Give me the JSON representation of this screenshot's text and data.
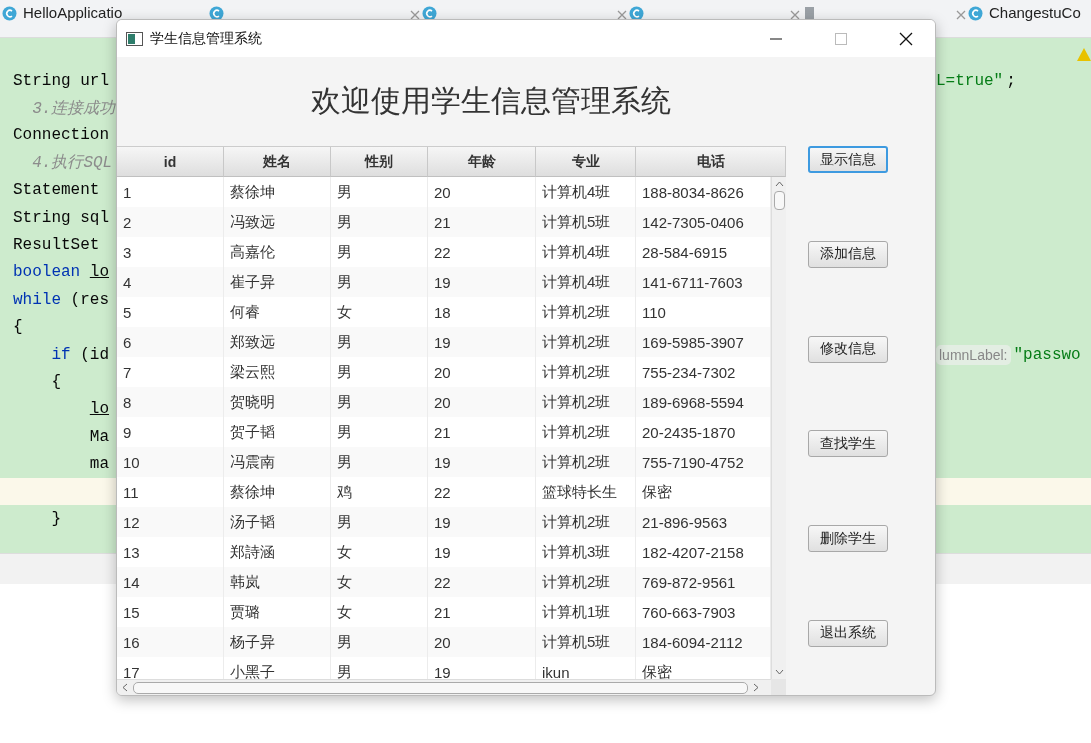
{
  "ide": {
    "tabs": [
      {
        "kind": "labeled",
        "label": "HelloApplicatio"
      },
      {
        "kind": "covered"
      },
      {
        "kind": "covered"
      },
      {
        "kind": "covered"
      },
      {
        "kind": "covered"
      },
      {
        "kind": "labeled",
        "label": "ChangestuCo"
      }
    ],
    "code_lines": [
      {
        "current": false,
        "segments": [
          {
            "kind": "plain",
            "text": "String url"
          }
        ],
        "tail": [
          {
            "kind": "string",
            "text": "L=true\""
          },
          {
            "kind": "plain",
            "text": ";"
          }
        ]
      },
      {
        "current": false,
        "segments": [
          {
            "kind": "comment",
            "text": "  3.连接成功"
          }
        ]
      },
      {
        "current": false,
        "segments": [
          {
            "kind": "plain",
            "text": "Connection"
          }
        ]
      },
      {
        "current": false,
        "segments": [
          {
            "kind": "comment",
            "text": "  4.执行SQL"
          }
        ]
      },
      {
        "current": false,
        "segments": [
          {
            "kind": "plain",
            "text": "Statement"
          }
        ]
      },
      {
        "current": false,
        "segments": [
          {
            "kind": "plain",
            "text": "String sql"
          }
        ]
      },
      {
        "current": false,
        "segments": [
          {
            "kind": "plain",
            "text": "ResultSet"
          }
        ]
      },
      {
        "current": false,
        "segments": [
          {
            "kind": "keyword",
            "text": "boolean "
          },
          {
            "kind": "underlined",
            "text": "lo"
          }
        ]
      },
      {
        "current": false,
        "segments": [
          {
            "kind": "keyword",
            "text": "while"
          },
          {
            "kind": "plain",
            "text": " (res"
          }
        ]
      },
      {
        "current": false,
        "segments": [
          {
            "kind": "plain",
            "text": "{"
          }
        ]
      },
      {
        "current": false,
        "segments": [
          {
            "kind": "keyword",
            "text": "    if"
          },
          {
            "kind": "plain",
            "text": " (id"
          }
        ],
        "tail": [
          {
            "kind": "hint",
            "text": "lumnLabel:"
          },
          {
            "kind": "string",
            "text": "\"passwo"
          }
        ]
      },
      {
        "current": false,
        "segments": [
          {
            "kind": "plain",
            "text": "    {"
          }
        ]
      },
      {
        "current": false,
        "segments": [
          {
            "kind": "underlined",
            "text": "        lo"
          }
        ]
      },
      {
        "current": false,
        "segments": [
          {
            "kind": "plain",
            "text": "        Ma"
          }
        ]
      },
      {
        "current": false,
        "segments": [
          {
            "kind": "plain",
            "text": "        ma"
          }
        ]
      },
      {
        "current": true
      },
      {
        "current": false,
        "segments": [
          {
            "kind": "plain",
            "text": "    }"
          }
        ]
      }
    ]
  },
  "window": {
    "title": "学生信息管理系统",
    "heading": "欢迎使用学生信息管理系统",
    "table": {
      "columns": [
        "id",
        "姓名",
        "性别",
        "年龄",
        "专业",
        "电话"
      ],
      "rows": [
        [
          "1",
          "蔡徐坤",
          "男",
          "20",
          "计算机4班",
          "188-8034-8626"
        ],
        [
          "2",
          "冯致远",
          "男",
          "21",
          "计算机5班",
          "142-7305-0406"
        ],
        [
          "3",
          "高嘉伦",
          "男",
          "22",
          "计算机4班",
          "28-584-6915"
        ],
        [
          "4",
          "崔子异",
          "男",
          "19",
          "计算机4班",
          "141-6711-7603"
        ],
        [
          "5",
          "何睿",
          "女",
          "18",
          "计算机2班",
          "110"
        ],
        [
          "6",
          "郑致远",
          "男",
          "19",
          "计算机2班",
          "169-5985-3907"
        ],
        [
          "7",
          "梁云熙",
          "男",
          "20",
          "计算机2班",
          "755-234-7302"
        ],
        [
          "8",
          "贺晓明",
          "男",
          "20",
          "计算机2班",
          "189-6968-5594"
        ],
        [
          "9",
          "贺子韬",
          "男",
          "21",
          "计算机2班",
          "20-2435-1870"
        ],
        [
          "10",
          "冯震南",
          "男",
          "19",
          "计算机2班",
          "755-7190-4752"
        ],
        [
          "11",
          "蔡徐坤",
          "鸡",
          "22",
          "篮球特长生",
          "保密"
        ],
        [
          "12",
          "汤子韬",
          "男",
          "19",
          "计算机2班",
          "21-896-9563"
        ],
        [
          "13",
          "郑詩涵",
          "女",
          "19",
          "计算机3班",
          "182-4207-2158"
        ],
        [
          "14",
          "韩岚",
          "女",
          "22",
          "计算机2班",
          "769-872-9561"
        ],
        [
          "15",
          "贾璐",
          "女",
          "21",
          "计算机1班",
          "760-663-7903"
        ],
        [
          "16",
          "杨子异",
          "男",
          "20",
          "计算机5班",
          "184-6094-2112"
        ],
        [
          "17",
          "小黑子",
          "男",
          "19",
          "ikun",
          "保密"
        ]
      ]
    },
    "buttons": [
      {
        "label": "显示信息",
        "focused": true
      },
      {
        "label": "添加信息",
        "focused": false
      },
      {
        "label": "修改信息",
        "focused": false
      },
      {
        "label": "查找学生",
        "focused": false
      },
      {
        "label": "删除学生",
        "focused": false
      },
      {
        "label": "退出系统",
        "focused": false
      }
    ]
  }
}
